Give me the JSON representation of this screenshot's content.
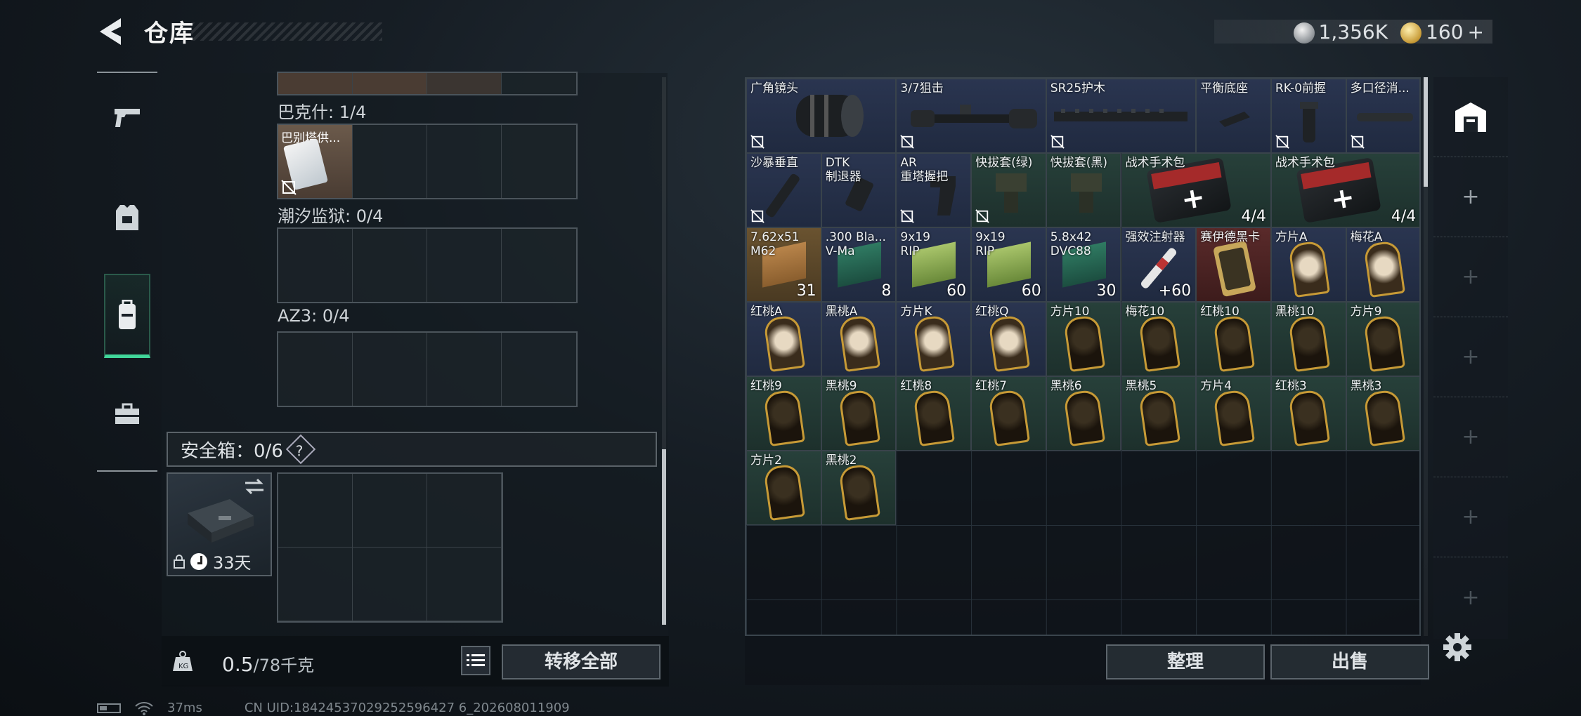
{
  "header": {
    "title": "仓库"
  },
  "currency": {
    "silver": "1,356K",
    "gold": "160",
    "add": "+"
  },
  "left": {
    "sections": [
      {
        "label": "巴克什: 1/4",
        "items": [
          {
            "label": "巴别塔供..."
          }
        ]
      },
      {
        "label": "潮汐监狱: 0/4"
      },
      {
        "label": "AZ3: 0/4"
      }
    ],
    "safe": {
      "label": "安全箱：0/6",
      "help": "?",
      "days": "33天"
    },
    "weight": {
      "value": "0.5",
      "max": "/78千克"
    },
    "transfer_all": "转移全部"
  },
  "stash": {
    "items": [
      {
        "name": "广角镜头"
      },
      {
        "name": "3/7狙击"
      },
      {
        "name": "SR25护木"
      },
      {
        "name": "平衡底座"
      },
      {
        "name": "RK-0前握"
      },
      {
        "name": "多口径消..."
      },
      {
        "name": "沙暴垂直"
      },
      {
        "name": "DTK\n制退器"
      },
      {
        "name": "AR\n重塔握把"
      },
      {
        "name": "快拔套(绿)"
      },
      {
        "name": "快拔套(黑)"
      },
      {
        "name": "战术手术包",
        "count": "4/4"
      },
      {
        "name": "战术手术包",
        "count": "4/4"
      },
      {
        "name": "7.62x51\nM62",
        "count": "31"
      },
      {
        "name": ".300 Bla...\nV-Ma",
        "count": "8"
      },
      {
        "name": "9x19\nRIP",
        "count": "60"
      },
      {
        "name": "9x19\nRIP",
        "count": "60"
      },
      {
        "name": "5.8x42\nDVC88",
        "count": "30"
      },
      {
        "name": "强效注射器",
        "count": "+60"
      },
      {
        "name": "赛伊德黑卡"
      },
      {
        "name": "方片A"
      },
      {
        "name": "梅花A"
      },
      {
        "name": "红桃A"
      },
      {
        "name": "黑桃A"
      },
      {
        "name": "方片K"
      },
      {
        "name": "红桃Q"
      },
      {
        "name": "方片10"
      },
      {
        "name": "梅花10"
      },
      {
        "name": "红桃10"
      },
      {
        "name": "黑桃10"
      },
      {
        "name": "方片9"
      },
      {
        "name": "红桃9"
      },
      {
        "name": "黑桃9"
      },
      {
        "name": "红桃8"
      },
      {
        "name": "红桃7"
      },
      {
        "name": "黑桃6"
      },
      {
        "name": "黑桃5"
      },
      {
        "name": "方片4"
      },
      {
        "name": "红桃3"
      },
      {
        "name": "黑桃3"
      },
      {
        "name": "方片2"
      },
      {
        "name": "黑桃2"
      }
    ],
    "sort": "整理",
    "sell": "出售"
  },
  "rail": {
    "plus": "+"
  },
  "status": {
    "ping": "37ms",
    "uid": "CN UID:18424537029252596427 6_202608011909"
  }
}
